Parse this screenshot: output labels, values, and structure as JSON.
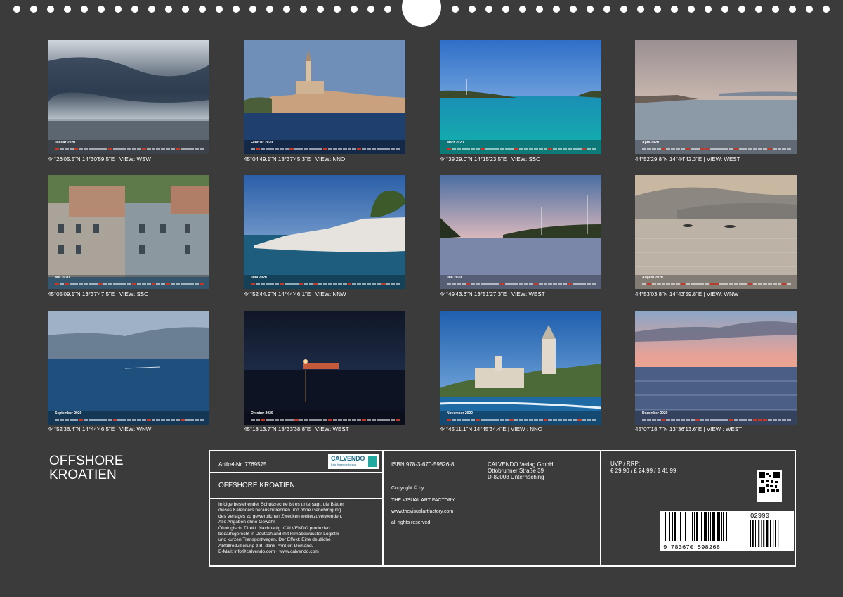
{
  "months": [
    {
      "label": "Januar 2020",
      "coord": "44°26'05.5\"N 14°30'59.5\"E | VIEW: WSW"
    },
    {
      "label": "Februar 2020",
      "coord": "45°04'49.1\"N 13°37'45.3\"E | VIEW: NNO"
    },
    {
      "label": "März 2020",
      "coord": "44°39'29.0\"N 14°15'23.5\"E | VIEW: SSO"
    },
    {
      "label": "April 2020",
      "coord": "44°52'29.8\"N 14°44'42.3\"E | VIEW: WEST"
    },
    {
      "label": "Mai 2020",
      "coord": "45°05'09.1\"N 13°37'47.5\"E | VIEW: SSO"
    },
    {
      "label": "Juni 2020",
      "coord": "44°52'44.9\"N 14°44'46.1\"E | VIEW: NNW"
    },
    {
      "label": "Juli 2020",
      "coord": "44°49'43.6\"N 13°51'27.3\"E | VIEW: WEST"
    },
    {
      "label": "August 2020",
      "coord": "44°53'03.8\"N 14°43'59.8\"E | VIEW: WNW"
    },
    {
      "label": "September 2020",
      "coord": "44°52'36.4\"N 14°44'46.5\"E | VIEW: WNW"
    },
    {
      "label": "Oktober 2020",
      "coord": "45°18'13.7\"N 13°33'38.8\"E | VIEW: WEST"
    },
    {
      "label": "November 2020",
      "coord": "44°45'11.1\"N 14°45'34.4\"E | VIEW : NNO"
    },
    {
      "label": "Dezember 2020",
      "coord": "45°07'18.7\"N 13°36'13.6\"E | VIEW : WEST"
    }
  ],
  "title": {
    "line1": "OFFSHORE",
    "line2": "KROATIEN"
  },
  "info": {
    "article": "Artikel-Nr. 7769575",
    "logo_text": "CALVENDO",
    "logo_tag": "Kein Kalenderbezug",
    "product_title": "OFFSHORE KROATIEN",
    "legal": [
      "Infolge bestehender Schutzrechte ist es untersagt, die Blätter",
      "dieses Kalenders herauszutrennen und ohne Genehmigung",
      "des Verlages zu gewerblichen Zwecken weiterzuverwenden.",
      "Alle Angaben ohne Gewähr.",
      "Ökologisch. Direkt. Nachhaltig. CALVENDO produziert",
      "bedarfsgerecht in Deutschland mit klimabewusster Logistik",
      "und kurzen Transportwegen. Der Effekt: Eine deutliche",
      "Abfallreduzierung z.B. dank Print-on-Demand.",
      "E-Mail: info@calvendo.com • www.calvendo.com"
    ],
    "isbn": "ISBN 978-3-670-59826-8",
    "copyright": "Copyright © by",
    "author": "THE VISUAL ART FACTORY",
    "website": "www.thevisualartfactory.com",
    "rights": "all rights reserved",
    "publisher": [
      "CALVENDO Verlag GmbH",
      "Ottobrunner Straße 39",
      "D-82008 Unterhaching"
    ],
    "uvp_label": "UVP / RRP:",
    "uvp_prices": "€ 29,90 / £ 24,99 / $ 41,99",
    "barcode_digits": "9 783670 598268",
    "barcode_addon": "02990"
  },
  "colors": {
    "background": "#3b3b3b",
    "panel_border": "#ffffff",
    "holiday": "#c0392b"
  }
}
